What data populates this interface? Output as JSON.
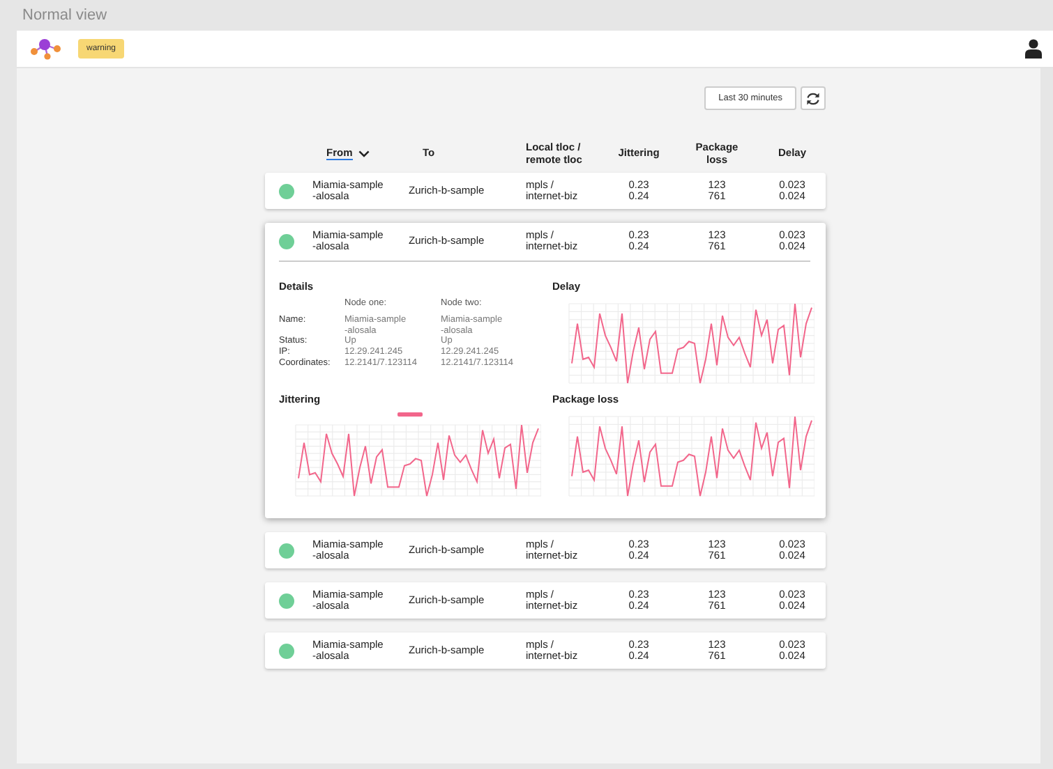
{
  "window": {
    "title": "Normal view"
  },
  "header": {
    "badge": "warning"
  },
  "toolbar": {
    "range_button": "Last 30 minutes"
  },
  "table": {
    "columns": [
      {
        "label": "From",
        "sorted": true
      },
      {
        "label": "To",
        "sorted": false
      },
      {
        "label": "Local tloc /\nremote tloc",
        "sorted": false
      },
      {
        "label": "Jittering",
        "sorted": false
      },
      {
        "label": "Package\nloss",
        "sorted": false
      },
      {
        "label": "Delay",
        "sorted": false
      }
    ],
    "rows": [
      {
        "color": "#6fcf97",
        "from": "Miamia-sample\n-alosala",
        "to": "Zurich-b-sample",
        "tloc": "mpls /\ninternet-biz",
        "jittering": "0.23\n0.24",
        "package_loss": "123\n761",
        "delay": "0.023\n0.024",
        "expanded": false
      },
      {
        "color": "#6fcf97",
        "from": "Miamia-sample\n-alosala",
        "to": "Zurich-b-sample",
        "tloc": "mpls /\ninternet-biz",
        "jittering": "0.23\n0.24",
        "package_loss": "123\n761",
        "delay": "0.023\n0.024",
        "expanded": true,
        "details": {
          "title": "Details",
          "node_headers": [
            "Node one:",
            "Node two:"
          ],
          "fields": [
            {
              "label": "Name:",
              "values": [
                "Miamia-sample\n-alosala",
                "Miamia-sample\n-alosala"
              ]
            },
            {
              "label": "Status:",
              "values": [
                "Up",
                "Up"
              ]
            },
            {
              "label": "IP:",
              "values": [
                "12.29.241.245",
                "12.29.241.245"
              ]
            },
            {
              "label": "Coordinates:",
              "values": [
                "12.2141/7.123114",
                "12.2141/7.123114"
              ]
            }
          ]
        },
        "charts": [
          {
            "title": "Delay",
            "legend": false
          },
          {
            "title": "Jittering",
            "legend": true
          },
          {
            "title": "Package loss",
            "legend": false
          }
        ]
      },
      {
        "color": "#6fcf97",
        "from": "Miamia-sample\n-alosala",
        "to": "Zurich-b-sample",
        "tloc": "mpls /\ninternet-biz",
        "jittering": "0.23\n0.24",
        "package_loss": "123\n761",
        "delay": "0.023\n0.024",
        "expanded": false
      },
      {
        "color": "#6fcf97",
        "from": "Miamia-sample\n-alosala",
        "to": "Zurich-b-sample",
        "tloc": "mpls /\ninternet-biz",
        "jittering": "0.23\n0.24",
        "package_loss": "123\n761",
        "delay": "0.023\n0.024",
        "expanded": false
      },
      {
        "color": "#6fcf97",
        "from": "Miamia-sample\n-alosala",
        "to": "Zurich-b-sample",
        "tloc": "mpls /\ninternet-biz",
        "jittering": "0.23\n0.24",
        "package_loss": "123\n761",
        "delay": "0.023\n0.024",
        "expanded": false
      }
    ]
  }
}
